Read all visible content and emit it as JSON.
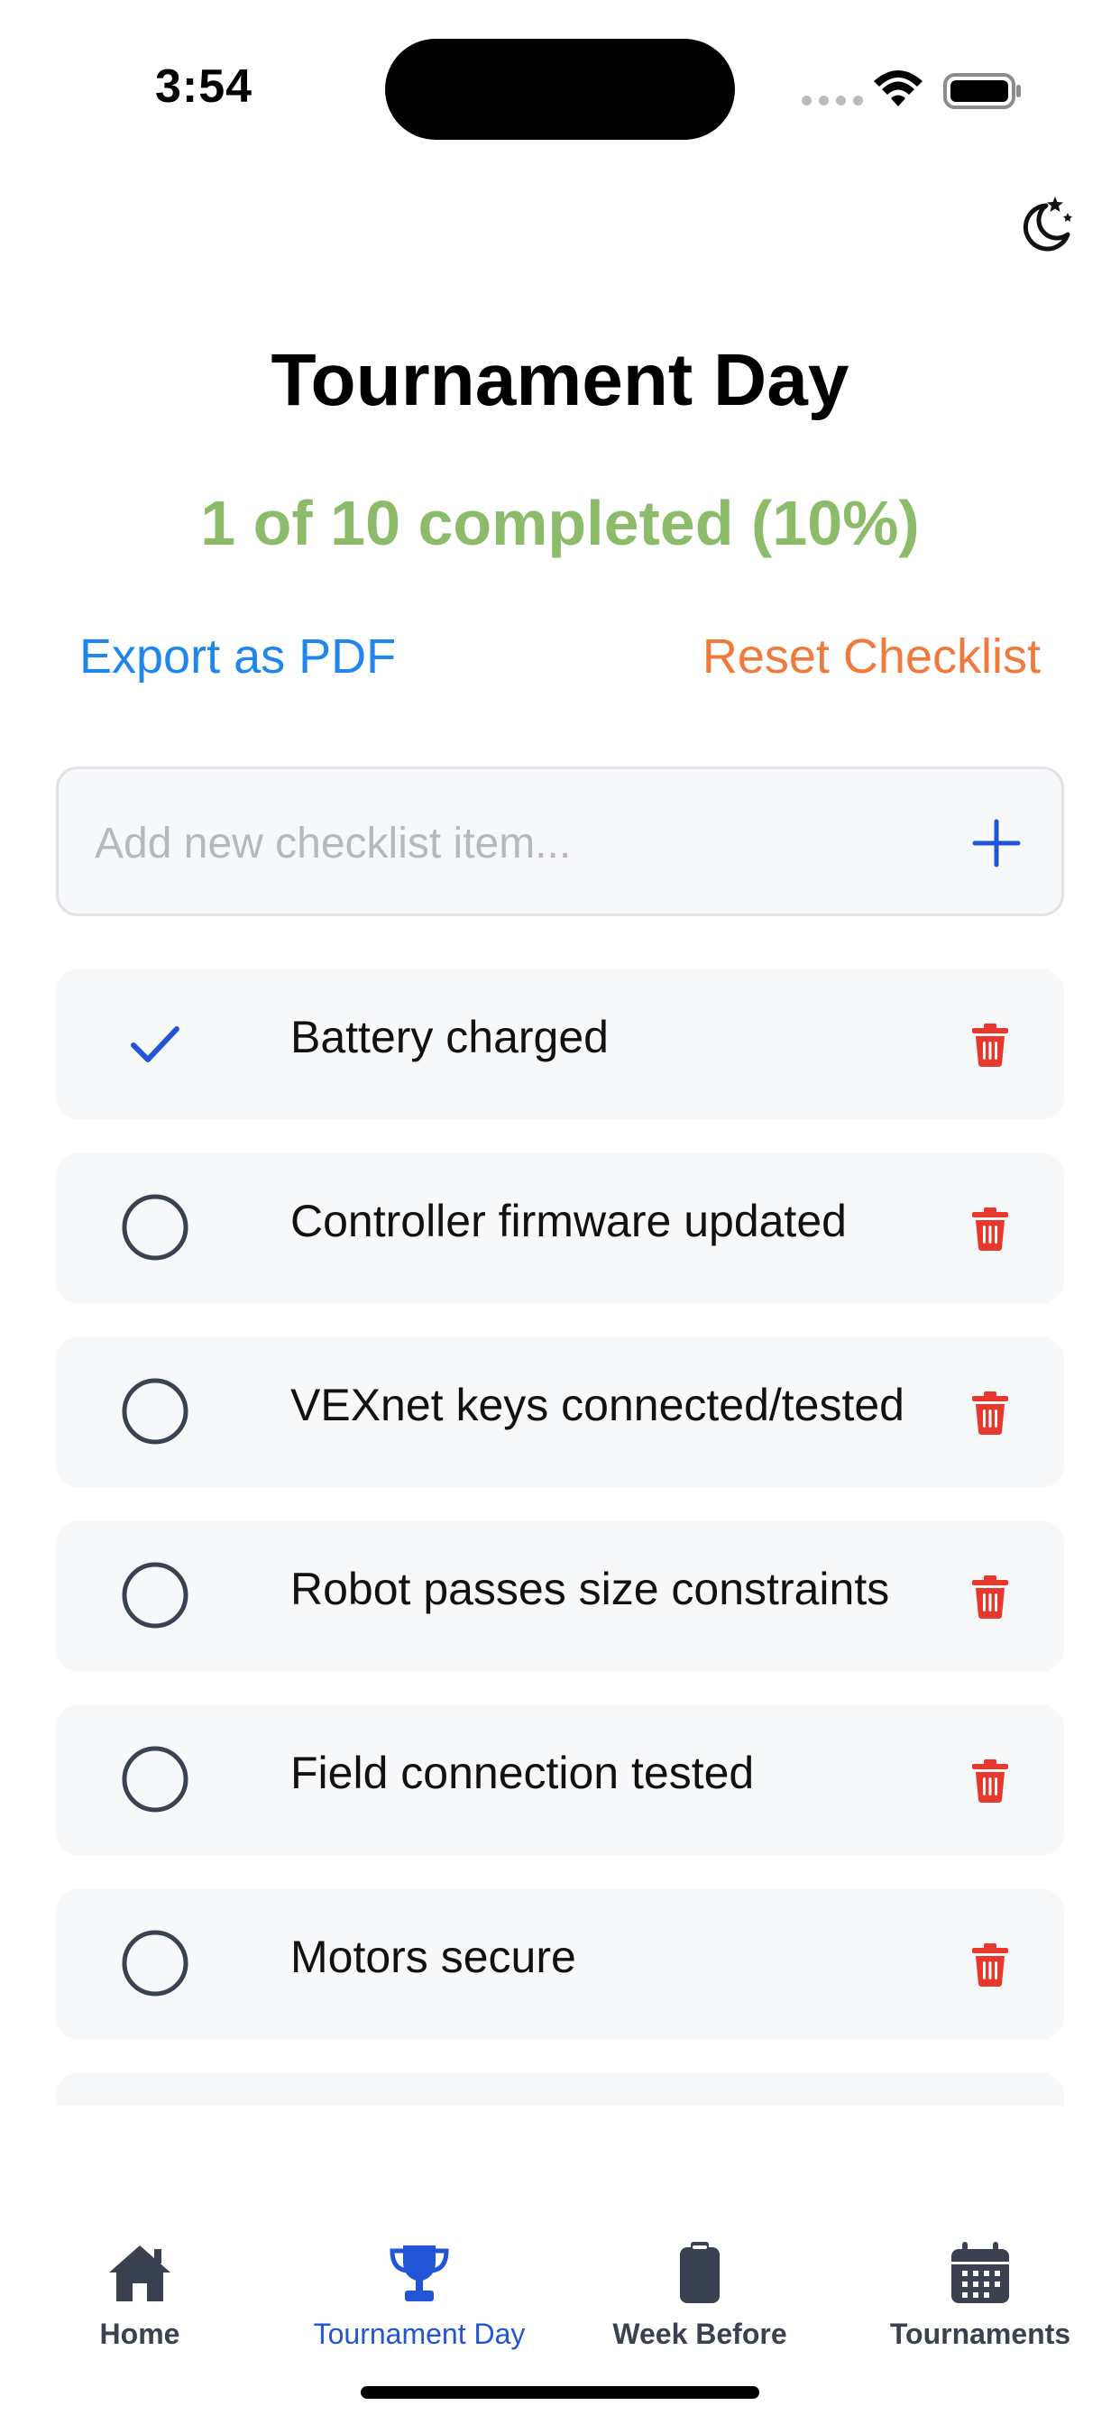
{
  "status_bar": {
    "time": "3:54"
  },
  "header": {
    "title": "Tournament Day",
    "progress": "1 of 10 completed (10%)",
    "progress_color": "#8cbc6a",
    "export_label": "Export as PDF",
    "reset_label": "Reset Checklist"
  },
  "add_item": {
    "placeholder": "Add new checklist item..."
  },
  "checklist": {
    "completed_count": 1,
    "total_count": 10,
    "items": [
      {
        "label": "Battery charged",
        "checked": true
      },
      {
        "label": "Controller firmware updated",
        "checked": false
      },
      {
        "label": "VEXnet keys connected/tested",
        "checked": false
      },
      {
        "label": "Robot passes size constraints",
        "checked": false
      },
      {
        "label": "Field connection tested",
        "checked": false
      },
      {
        "label": "Motors secure",
        "checked": false
      }
    ]
  },
  "tabs": [
    {
      "label": "Home",
      "icon": "home-icon",
      "active": false
    },
    {
      "label": "Tournament Day",
      "icon": "trophy-icon",
      "active": true
    },
    {
      "label": "Week Before",
      "icon": "clipboard-icon",
      "active": false
    },
    {
      "label": "Tournaments",
      "icon": "calendar-icon",
      "active": false
    }
  ],
  "colors": {
    "accent_blue": "#1f86ee",
    "reset_orange": "#f07a3c",
    "delete_red": "#e8382e",
    "active_tab": "#2154d6",
    "inactive_tab": "#3a4150"
  }
}
